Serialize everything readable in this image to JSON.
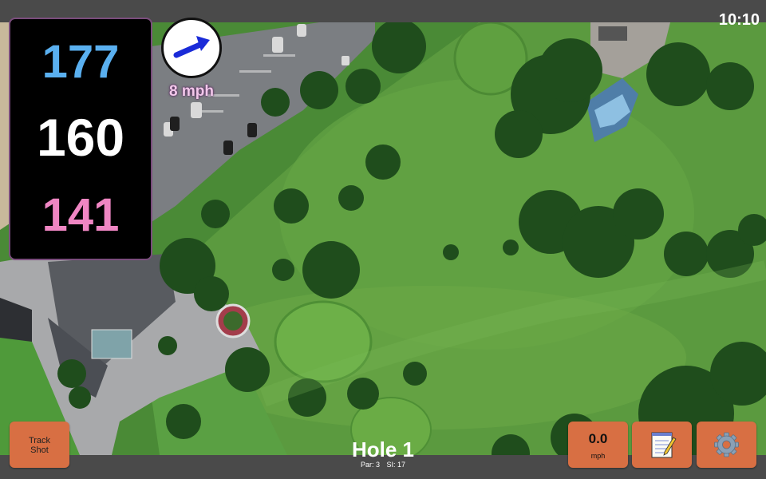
{
  "status": {
    "time": "10:10"
  },
  "distances": {
    "back": "177",
    "middle": "160",
    "front": "141"
  },
  "wind": {
    "speed_label": "8 mph",
    "direction_icon": "arrow-up-right-icon"
  },
  "hole": {
    "title": "Hole 1",
    "par_label": "Par: 3",
    "si_label": "SI: 17"
  },
  "buttons": {
    "track_shot_line1": "Track",
    "track_shot_line2": "Shot",
    "speed_value": "0.0",
    "speed_unit": "mph",
    "notes_icon": "notepad-icon",
    "settings_icon": "gear-icon"
  },
  "colors": {
    "back_distance": "#5ab0f0",
    "middle_distance": "#ffffff",
    "front_distance": "#ef86c3",
    "button_accent": "#d86f43"
  }
}
